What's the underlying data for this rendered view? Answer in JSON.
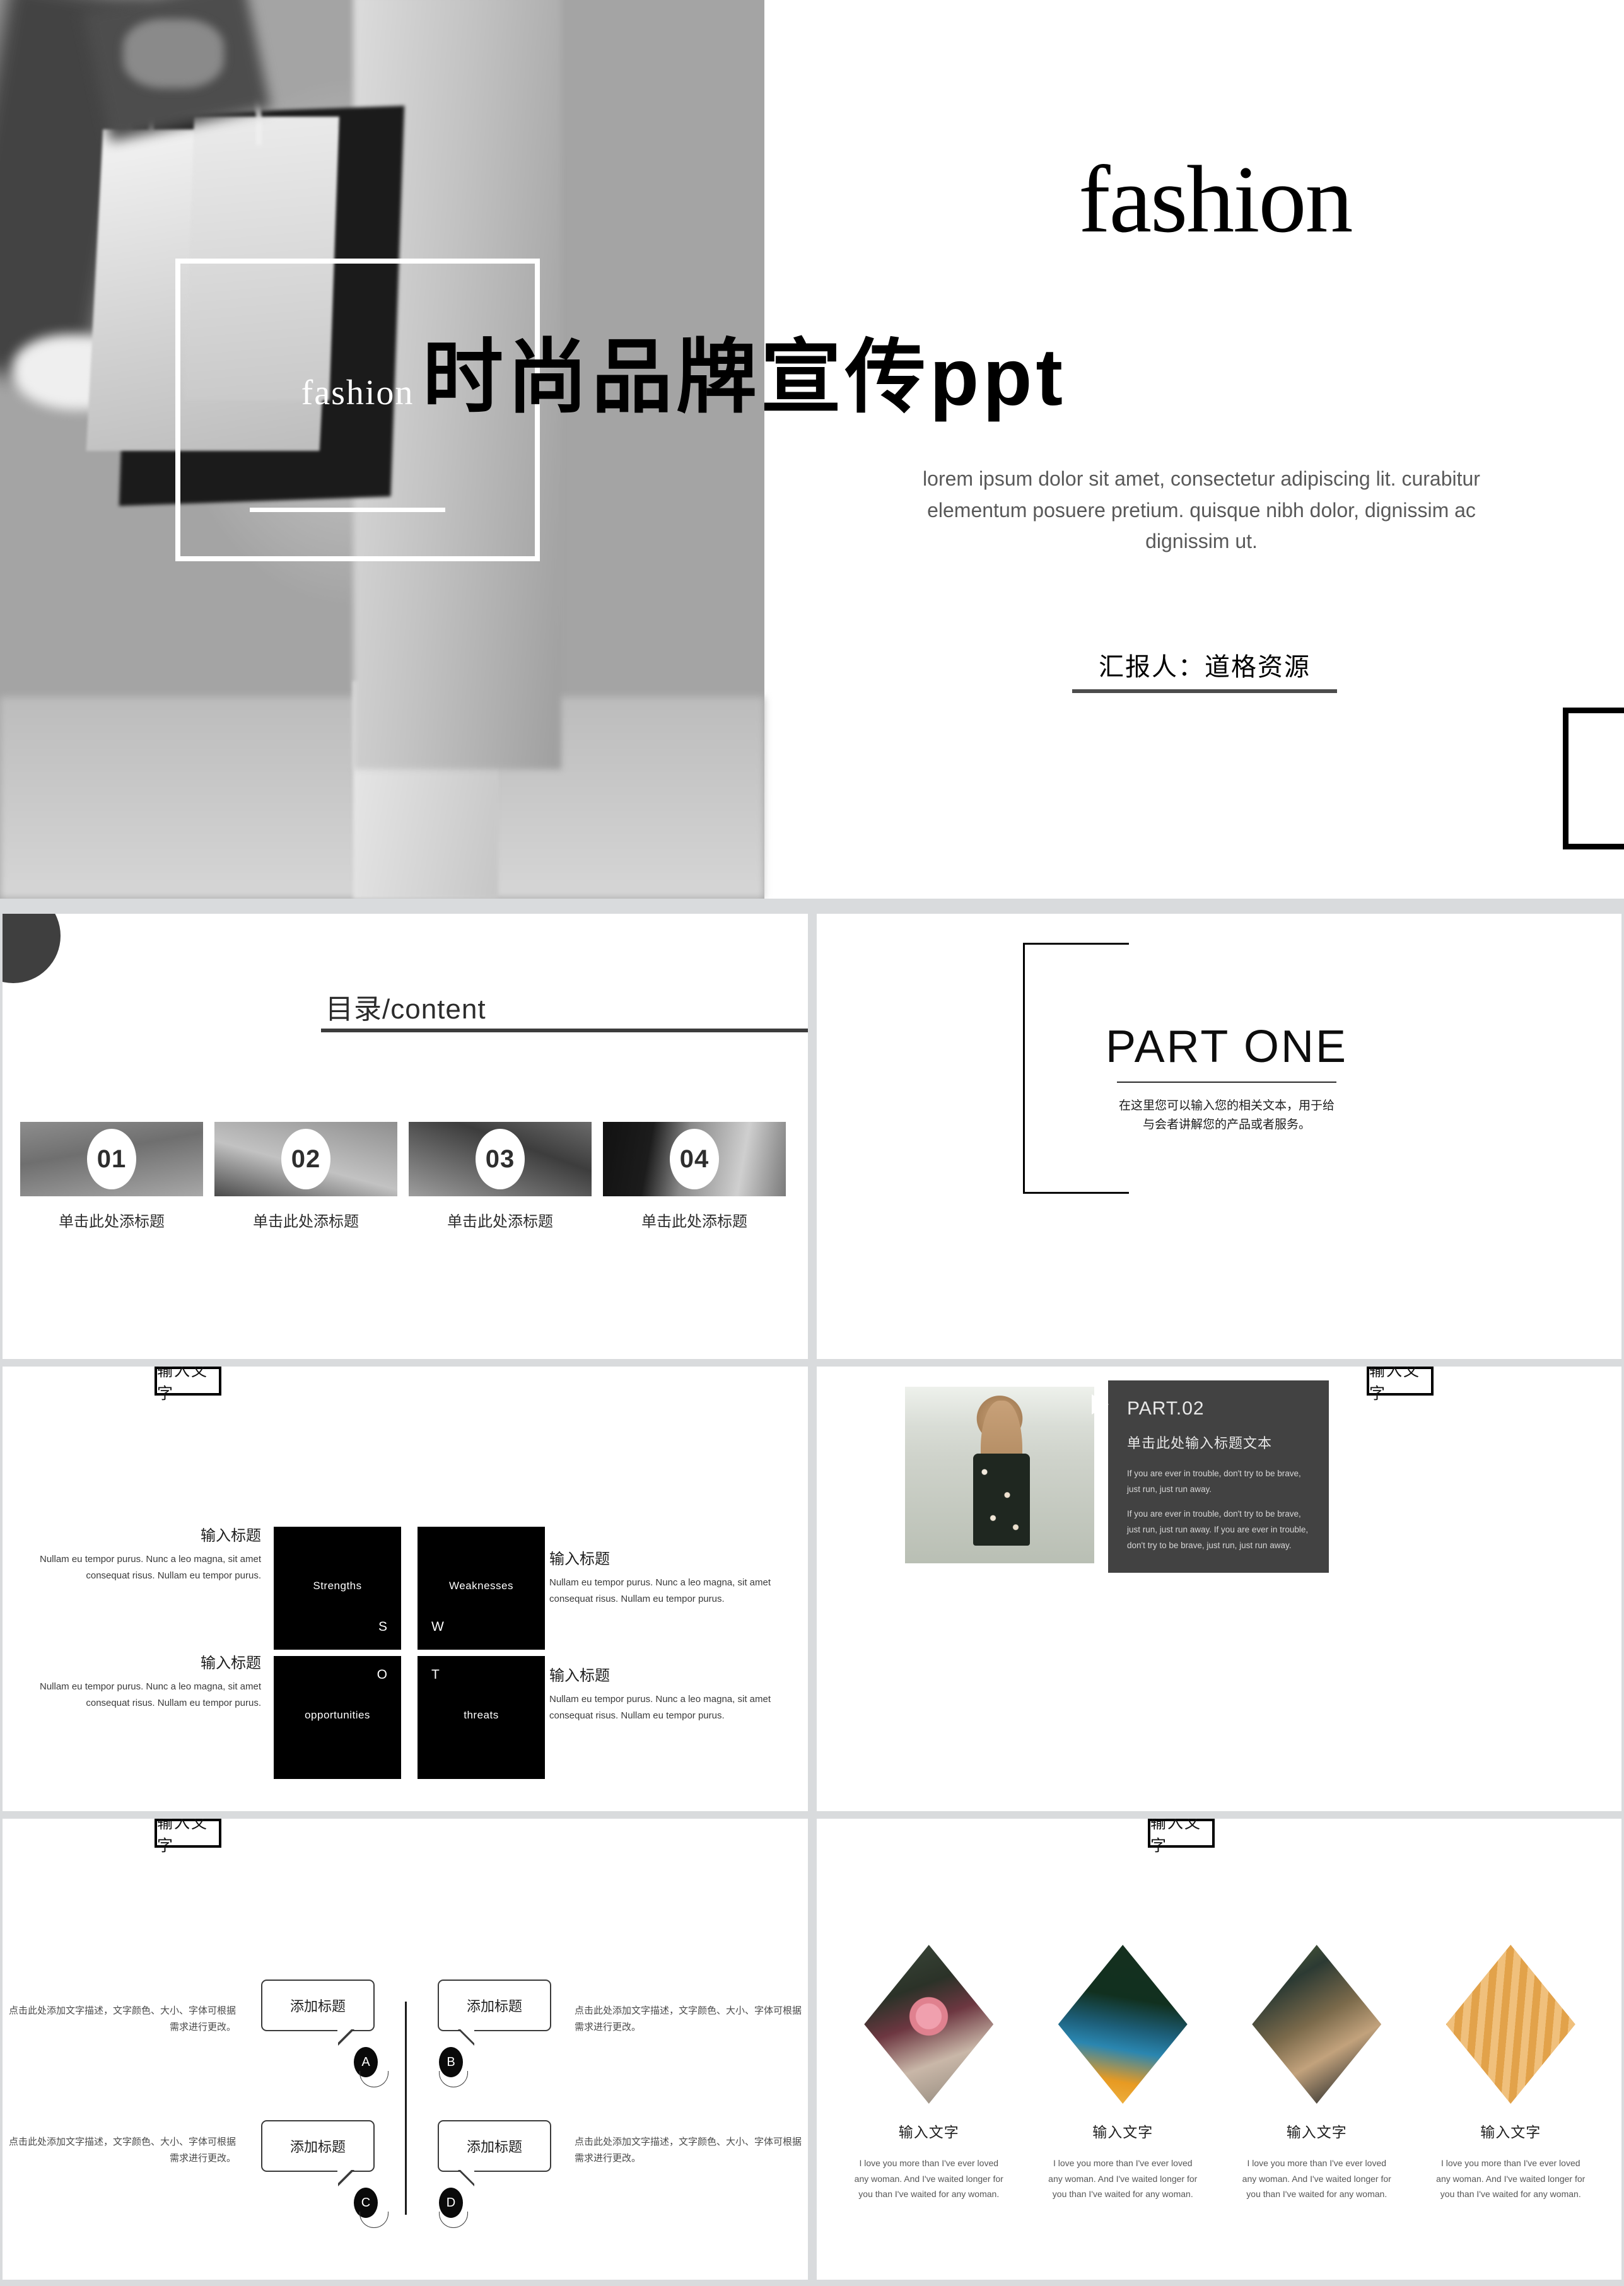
{
  "slide1": {
    "frame_word": "fashion",
    "title_en": "fashion",
    "title_cn": "时尚品牌宣传ppt",
    "subtitle": "lorem ipsum dolor sit amet, consectetur adipiscing lit. curabitur elementum posuere pretium. quisque nibh dolor, dignissim ac dignissim ut.",
    "speaker": "汇报人：道格资源"
  },
  "slide2": {
    "title": "目录/content",
    "items": [
      {
        "number": "01",
        "caption": "单击此处添标题"
      },
      {
        "number": "02",
        "caption": "单击此处添标题"
      },
      {
        "number": "03",
        "caption": "单击此处添标题"
      },
      {
        "number": "04",
        "caption": "单击此处添标题"
      }
    ]
  },
  "slide3": {
    "part": "PART ONE",
    "desc": "在这里您可以输入您的相关文本，用于给与会者讲解您的产品或者服务。"
  },
  "slide4": {
    "tab": "输入文字",
    "cells": [
      {
        "key": "S",
        "word": "Strengths"
      },
      {
        "key": "W",
        "word": "Weaknesses"
      },
      {
        "key": "O",
        "word": "opportunities"
      },
      {
        "key": "T",
        "word": "threats"
      }
    ],
    "texts": [
      {
        "title": "输入标题",
        "body": "Nullam eu tempor purus. Nunc a leo magna, sit amet consequat risus. Nullam eu tempor purus."
      },
      {
        "title": "输入标题",
        "body": "Nullam eu tempor purus. Nunc a leo magna, sit amet consequat risus. Nullam eu tempor purus."
      },
      {
        "title": "输入标题",
        "body": "Nullam eu tempor purus. Nunc a leo magna, sit amet consequat risus. Nullam eu tempor purus."
      },
      {
        "title": "输入标题",
        "body": "Nullam eu tempor purus. Nunc a leo magna, sit amet consequat risus. Nullam eu tempor purus."
      }
    ]
  },
  "slide5": {
    "tab": "输入文字",
    "part": "PART.02",
    "heading": "单击此处输入标题文本",
    "para1": "If you are ever in trouble, don't try to be brave, just run, just run away.",
    "para2": "If you are ever in trouble, don't try to be brave, just run, just run away. If you are ever in trouble, don't try to be brave, just run, just run away."
  },
  "slide6": {
    "tab": "输入文字",
    "bubbles": [
      {
        "label": "添加标题",
        "node": "A"
      },
      {
        "label": "添加标题",
        "node": "B"
      },
      {
        "label": "添加标题",
        "node": "C"
      },
      {
        "label": "添加标题",
        "node": "D"
      }
    ],
    "texts": [
      "点击此处添加文字描述，文字颜色、大小、字体可根据需求进行更改。",
      "点击此处添加文字描述，文字颜色、大小、字体可根据需求进行更改。",
      "点击此处添加文字描述，文字颜色、大小、字体可根据需求进行更改。",
      "点击此处添加文字描述，文字颜色、大小、字体可根据需求进行更改。"
    ]
  },
  "slide7": {
    "tab": "输入文字",
    "items": [
      {
        "title": "输入文字",
        "body": "I love you more than I've ever loved any woman. And I've waited longer for you than I've waited for any woman."
      },
      {
        "title": "输入文字",
        "body": "I love you more than I've ever loved any woman. And I've waited longer for you than I've waited for any woman."
      },
      {
        "title": "输入文字",
        "body": "I love you more than I've ever loved any woman. And I've waited longer for you than I've waited for any woman."
      },
      {
        "title": "输入文字",
        "body": "I love you more than I've ever loved any woman. And I've waited longer for you than I've waited for any woman."
      }
    ]
  },
  "colors": {
    "panel_gray": "#424242",
    "swot_black": "#000000",
    "rule_dark": "#3c3c3c",
    "page_bg": "#d9dbdd"
  }
}
